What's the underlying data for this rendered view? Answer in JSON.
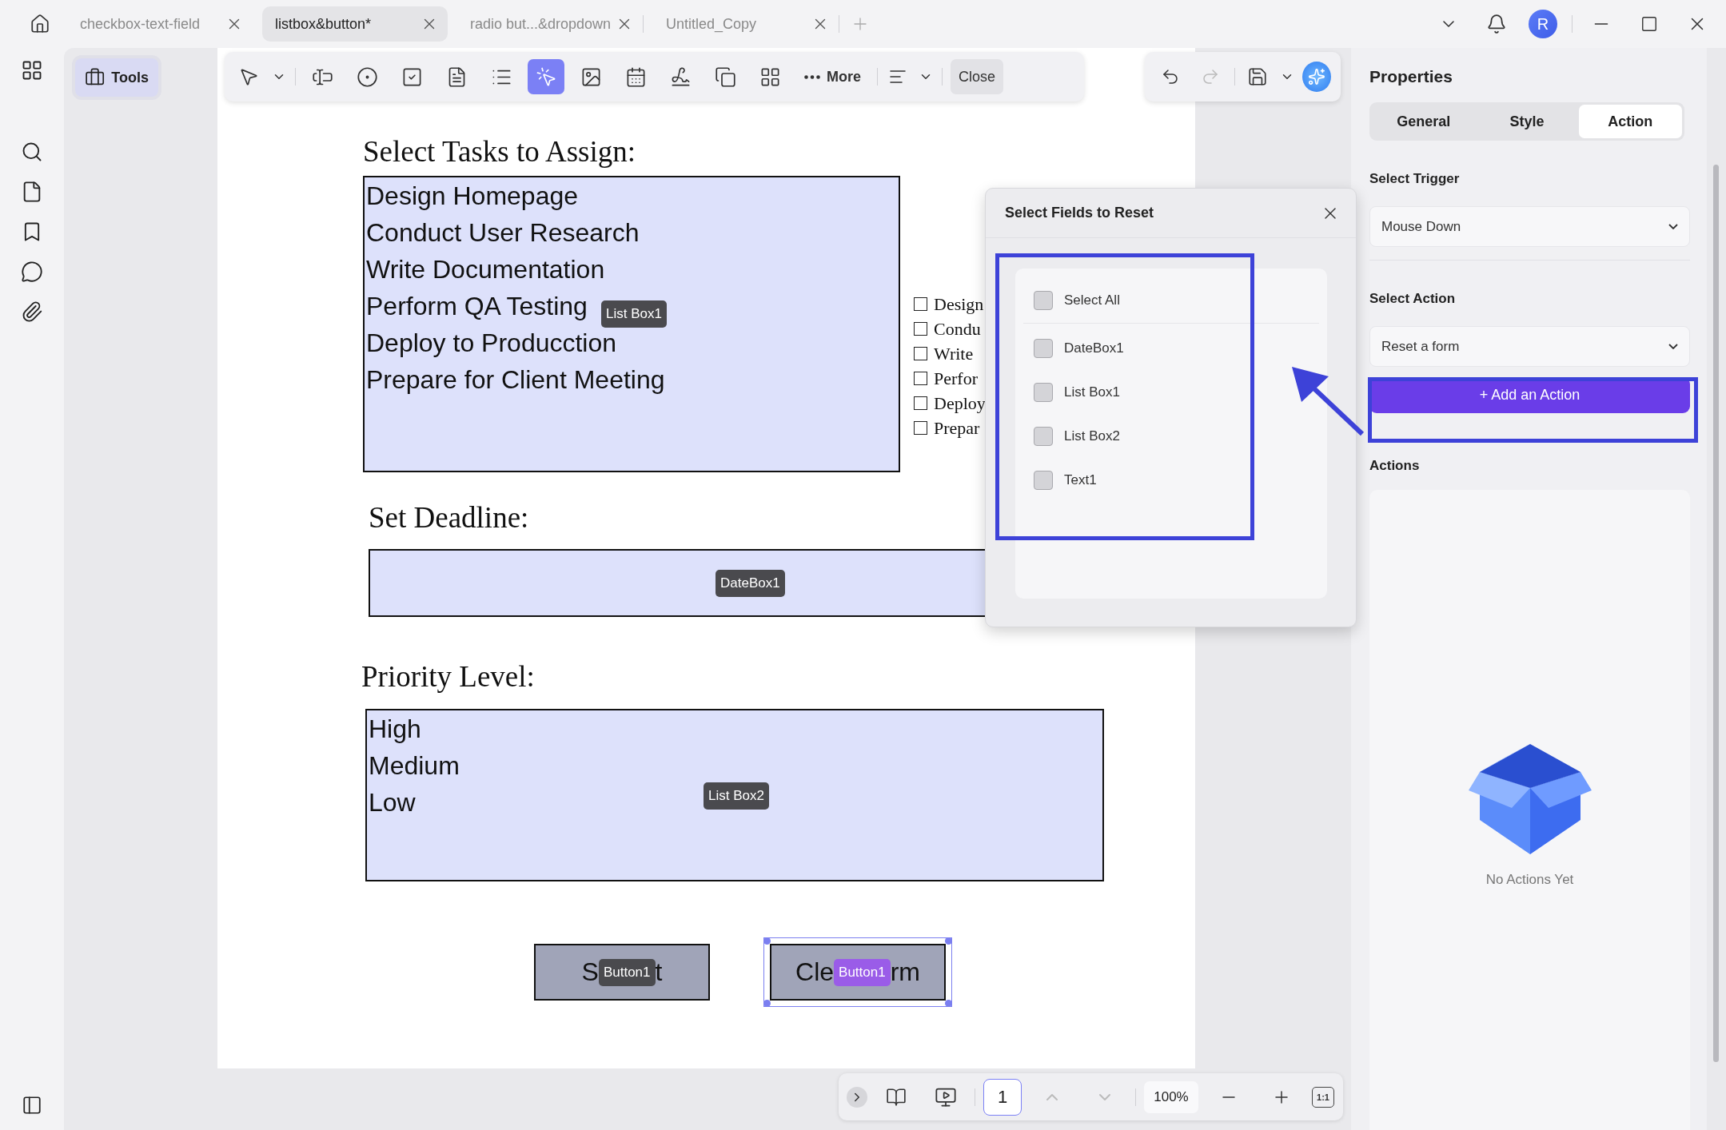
{
  "tabs": [
    {
      "label": "checkbox-text-field",
      "selected": false
    },
    {
      "label": "listbox&button*",
      "selected": true
    },
    {
      "label": "radio but...&dropdown",
      "selected": false
    },
    {
      "label": "Untitled_Copy",
      "selected": false
    }
  ],
  "avatar": "R",
  "tools_button": "Tools",
  "toolbar": {
    "tools": [
      {
        "kind": "text-field",
        "selected": false
      },
      {
        "kind": "radio",
        "selected": false
      },
      {
        "kind": "checkbox",
        "selected": false
      },
      {
        "kind": "combo",
        "selected": false
      },
      {
        "kind": "list",
        "selected": false
      },
      {
        "kind": "button",
        "selected": true
      },
      {
        "kind": "image",
        "selected": false
      },
      {
        "kind": "date",
        "selected": false
      },
      {
        "kind": "signature",
        "selected": false
      },
      {
        "kind": "copy",
        "selected": false
      },
      {
        "kind": "grid",
        "selected": false
      }
    ],
    "more": "More",
    "close": "Close"
  },
  "form": {
    "tasks_heading": "Select Tasks to Assign:",
    "task_list": {
      "items": [
        "Design Homepage",
        "Conduct User Research",
        "Write Documentation",
        "Perform QA Testing",
        "Deploy to Producction",
        "Prepare for Client Meeting"
      ],
      "tag": "List Box1"
    },
    "task_checkboxes": [
      {
        "label": "Design",
        "checked": false
      },
      {
        "label": "Condu",
        "checked": false
      },
      {
        "label": "Write",
        "checked": false
      },
      {
        "label": "Perfor",
        "checked": false
      },
      {
        "label": "Deploy",
        "checked": false
      },
      {
        "label": "Prepar",
        "checked": false
      }
    ],
    "deadline_heading": "Set Deadline:",
    "date_field": {
      "tag": "DateBox1"
    },
    "priority_heading": "Priority Level:",
    "priority_list": {
      "items": [
        "High",
        "Medium",
        "Low"
      ],
      "tag": "List Box2"
    },
    "buttons": [
      {
        "label_start": "S",
        "label_end": "t",
        "tag": "Button1",
        "selected": false
      },
      {
        "label_start": "Cle",
        "label_end": "rm",
        "tag": "Button1",
        "selected": true
      }
    ]
  },
  "dialog": {
    "title": "Select Fields to Reset",
    "fields": [
      {
        "label": "Select All",
        "checked": false
      },
      {
        "label": "DateBox1",
        "checked": false
      },
      {
        "label": "List Box1",
        "checked": false
      },
      {
        "label": "List Box2",
        "checked": false
      },
      {
        "label": "Text1",
        "checked": false
      }
    ]
  },
  "properties": {
    "title": "Properties",
    "tabs": [
      {
        "label": "General",
        "selected": false
      },
      {
        "label": "Style",
        "selected": false
      },
      {
        "label": "Action",
        "selected": true
      }
    ],
    "trigger_label": "Select Trigger",
    "trigger": "Mouse Down",
    "action_label": "Select Action",
    "action": "Reset a form",
    "add_button": "+ Add an Action",
    "actions_label": "Actions",
    "empty_text": "No Actions Yet"
  },
  "bottom_bar": {
    "page": "1",
    "zoom": "100%",
    "fit": "1:1"
  }
}
